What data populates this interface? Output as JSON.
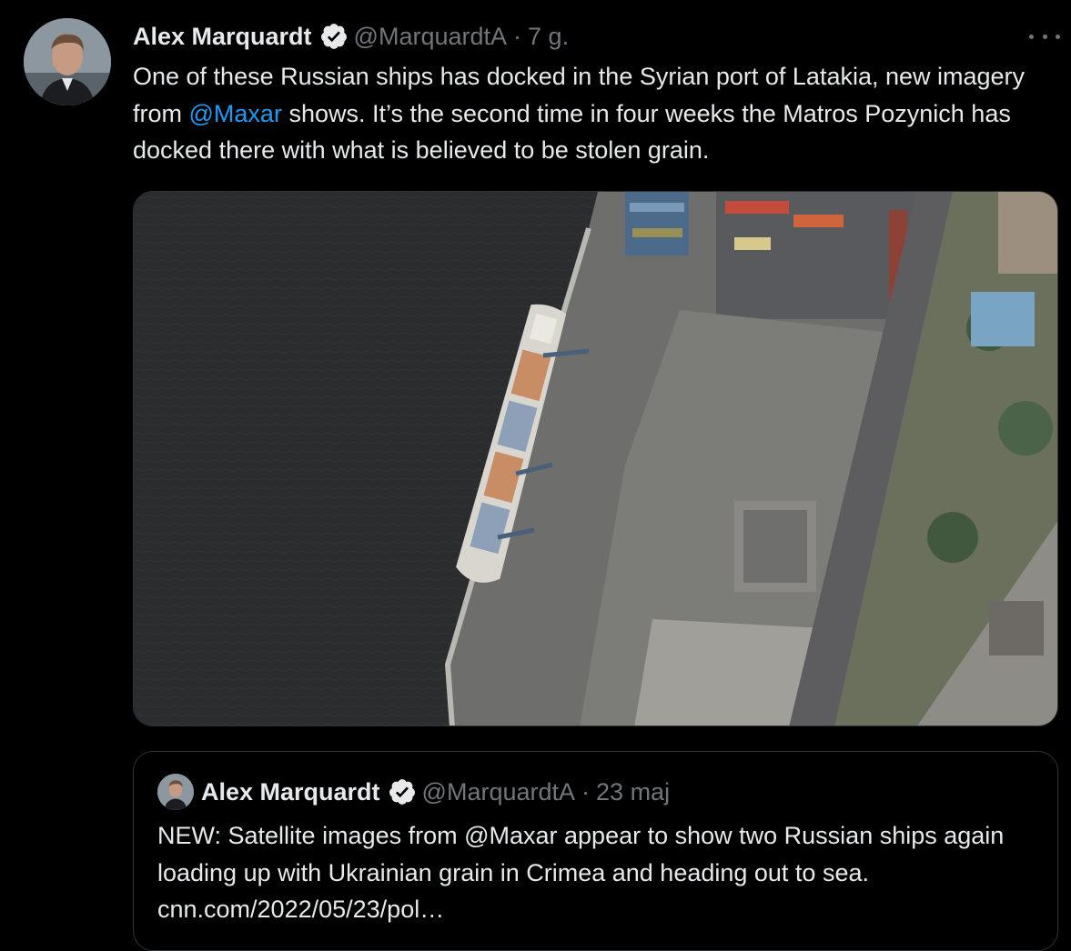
{
  "tweet": {
    "author_name": "Alex Marquardt",
    "handle": "@MarquardtA",
    "separator": "·",
    "time": "7 g.",
    "text_before": "One of these Russian ships has docked in the Syrian port of Latakia, new imagery from ",
    "mention": "@Maxar",
    "text_after": " shows. It’s the second time in four weeks the Matros Pozynich has docked there with what is believed to be stolen grain.",
    "more_icon": "more-horizontal-icon",
    "verified_icon": "verified-badge-icon"
  },
  "quote": {
    "author_name": "Alex Marquardt",
    "handle": "@MarquardtA",
    "separator": "·",
    "time": "23 maj",
    "text": "NEW: Satellite images from @Maxar appear to show two Russian ships again loading up with Ukrainian grain in Crimea and heading out to sea.",
    "link": "cnn.com/2022/05/23/pol…"
  },
  "colors": {
    "background": "#000000",
    "text": "#e7e9ea",
    "muted": "#71767b",
    "link": "#1d9bf0",
    "border": "#2f3336"
  }
}
